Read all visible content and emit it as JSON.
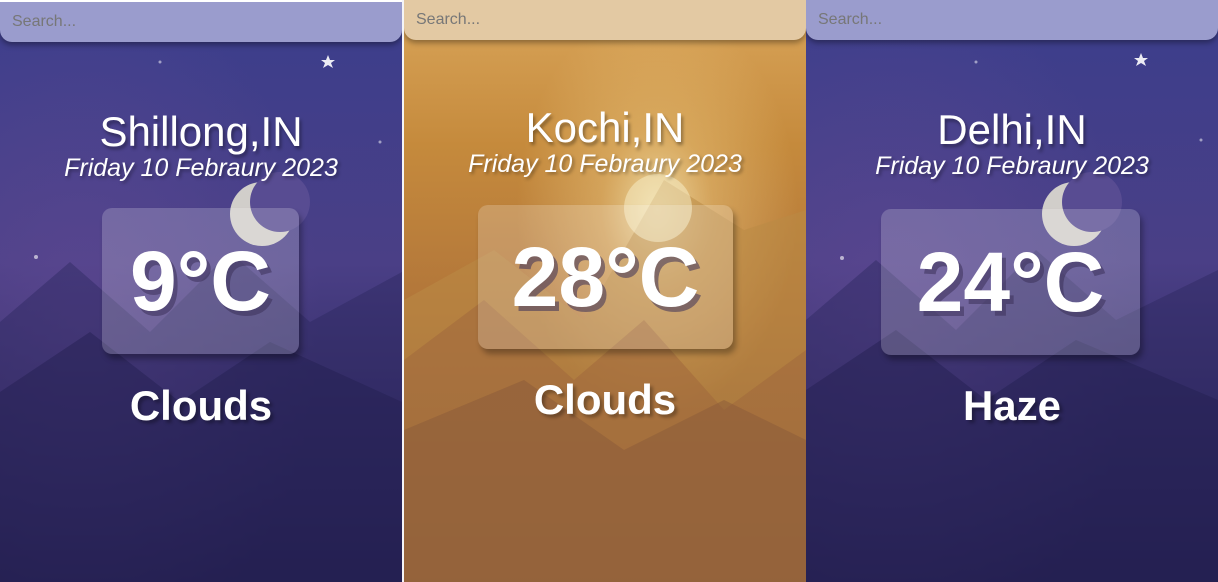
{
  "panels": [
    {
      "search_placeholder": "Search...",
      "city": "Shillong,IN",
      "date": "Friday 10 Febraury 2023",
      "temperature": "9°C",
      "condition": "Clouds",
      "theme": "night",
      "icon": "moon-icon"
    },
    {
      "search_placeholder": "Search...",
      "city": "Kochi,IN",
      "date": "Friday 10 Febraury 2023",
      "temperature": "28°C",
      "condition": "Clouds",
      "theme": "day",
      "icon": "sun-icon"
    },
    {
      "search_placeholder": "Search...",
      "city": "Delhi,IN",
      "date": "Friday 10 Febraury 2023",
      "temperature": "24°C",
      "condition": "Haze",
      "theme": "night",
      "icon": "moon-icon"
    }
  ],
  "colors": {
    "night_sky_top": "#3b3e8c",
    "night_sky_bottom": "#1f1a46",
    "day_sky_top": "#c08433",
    "day_sky_bottom": "#7a4f34",
    "search_night": "#9a9ccd",
    "search_day": "#e3c9a3",
    "text": "#ffffff"
  }
}
